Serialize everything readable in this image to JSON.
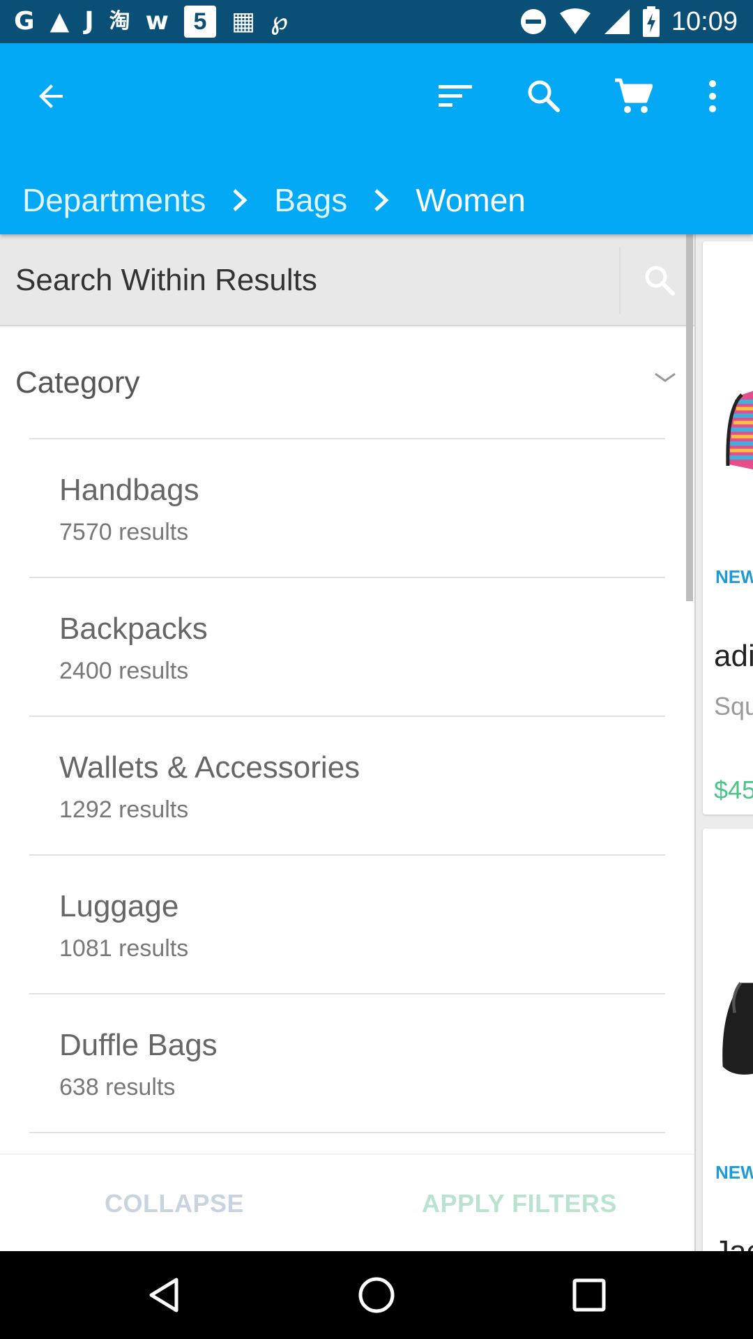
{
  "status_bar": {
    "left_icons": [
      "google-icon",
      "drive-icon",
      "j-app-icon",
      "taobao-icon",
      "wish-icon",
      "five-app-icon",
      "grid-app-icon",
      "link-app-icon"
    ],
    "left_glyphs": [
      "G",
      "▲",
      "J",
      "淘",
      "w",
      "5",
      "▦",
      "℘"
    ],
    "time": "10:09"
  },
  "app_bar": {
    "background": "#03a9f4",
    "breadcrumb": [
      "Departments",
      "Bags",
      "Women"
    ]
  },
  "search": {
    "placeholder": "Search Within Results"
  },
  "filters": {
    "category_title": "Category",
    "categories": [
      {
        "name": "Handbags",
        "count": "7570 results"
      },
      {
        "name": "Backpacks",
        "count": "2400 results"
      },
      {
        "name": "Wallets & Accessories",
        "count": "1292 results"
      },
      {
        "name": "Luggage",
        "count": "1081 results"
      },
      {
        "name": "Duffle Bags",
        "count": "638 results"
      }
    ],
    "collapse_label": "COLLAPSE",
    "apply_label": "APPLY FILTERS"
  },
  "products": [
    {
      "badge": "NEW",
      "title": "adi",
      "subtitle": "Squ",
      "price": "$45"
    },
    {
      "badge": "NEW",
      "title": "Jac"
    }
  ],
  "colors": {
    "status_bar": "#0a4f75",
    "accent": "#03a9f4",
    "price": "#4cc38a",
    "badge": "#1e9ad6"
  }
}
